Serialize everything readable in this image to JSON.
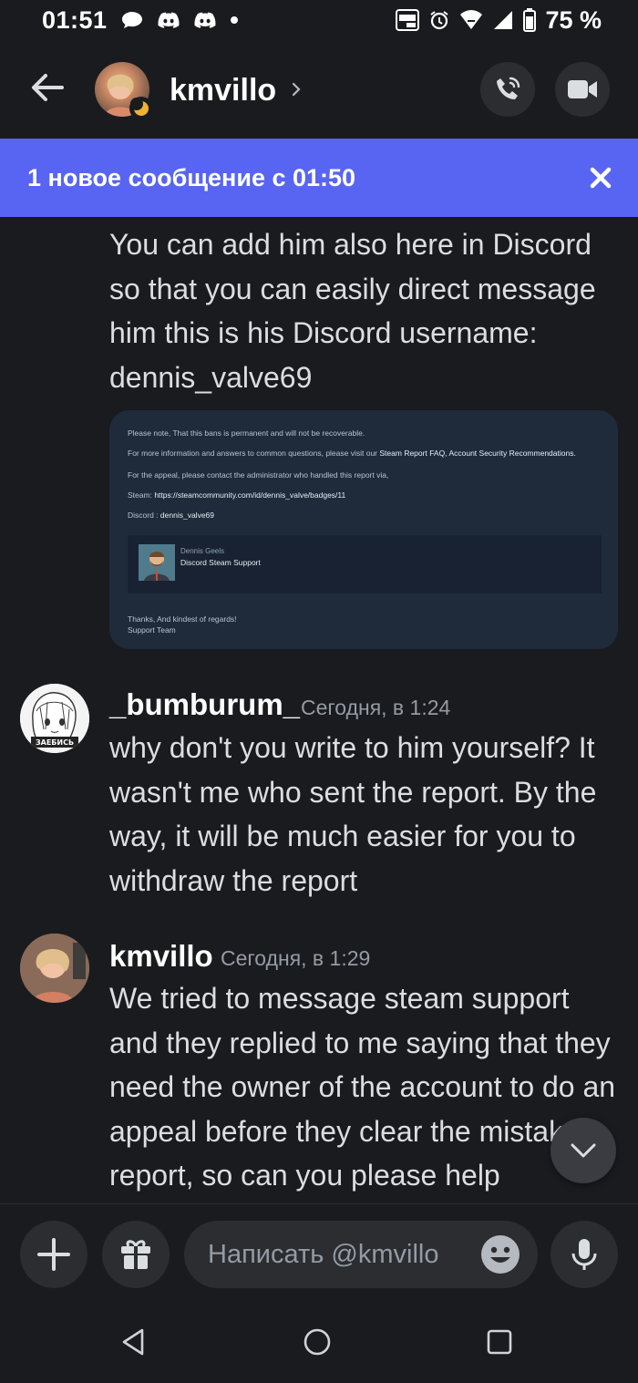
{
  "status_bar": {
    "time": "01:51",
    "battery": "75 %",
    "icons": [
      "chat-bubble-icon",
      "discord-icon",
      "discord-icon",
      "dot-icon",
      "auto-hz-icon",
      "alarm-icon",
      "wifi-icon",
      "signal-icon",
      "battery-icon"
    ]
  },
  "header": {
    "username": "kmvillo",
    "status": "idle",
    "icons": [
      "back-arrow-icon",
      "chevron-right-icon",
      "phone-call-icon",
      "video-camera-icon"
    ]
  },
  "banner": {
    "text": "1 новое сообщение с 01:50",
    "close_icon": "close-icon",
    "color": "#5865f2"
  },
  "messages": [
    {
      "text": "You can add him also here in Discord so that you can easily direct message him this is his Discord username: dennis_valve69",
      "attachment": {
        "lines": [
          "Please note, That this bans is permanent and will not be recoverable.",
          "For more information and answers to common questions, please visit our",
          "Steam Report FAQ, Account Security Recommendations.",
          "For the appeal, please contact the administrator who handled this report via,",
          "Steam:",
          "https://steamcommunity.com/id/dennis_valve/badges/11",
          "Discord :",
          "dennis_valve69",
          "Dennis Geels",
          "Discord Steam Support",
          "Thanks, And kindest of regards!",
          "Support Team"
        ]
      }
    },
    {
      "author": "_bumburum_",
      "timestamp": "Сегодня, в 1:24",
      "avatar_text": "ЗАЕБИСЬ",
      "text": "why don't you write to him yourself? It wasn't me who sent the report. By the way, it will be much easier for you to withdraw the report"
    },
    {
      "author": "kmvillo",
      "timestamp": "Сегодня, в 1:29",
      "text": "We tried to message steam support and they replied to me saying that they need the owner of the account to do an appeal before they clear the mistake report, so can you please help"
    }
  ],
  "composer": {
    "placeholder": "Написать @kmvillo",
    "icons": [
      "plus-icon",
      "gift-icon",
      "emoji-icon",
      "microphone-icon"
    ]
  },
  "scroll_down_icon": "chevron-down-icon",
  "nav_bar": {
    "icons": [
      "nav-back-icon",
      "nav-home-icon",
      "nav-recents-icon"
    ]
  }
}
